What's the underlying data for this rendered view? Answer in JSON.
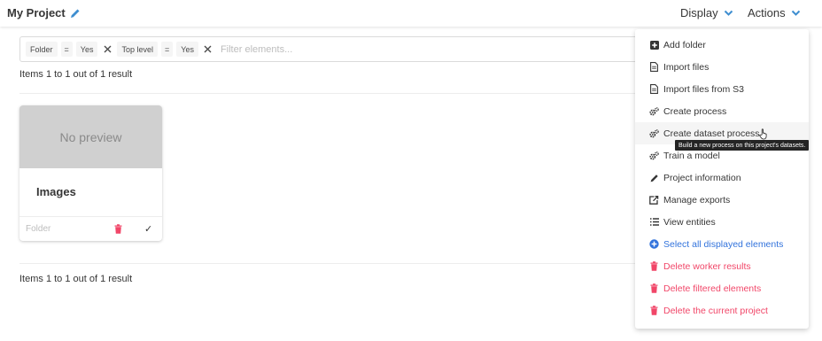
{
  "header": {
    "title": "My Project",
    "display_label": "Display",
    "actions_label": "Actions"
  },
  "filters": {
    "tags": [
      {
        "field": "Folder",
        "operator": "=",
        "value": "Yes"
      },
      {
        "field": "Top level",
        "operator": "=",
        "value": "Yes"
      }
    ],
    "placeholder": "Filter elements..."
  },
  "results": {
    "top_count": "Items 1 to 1 out of 1 result",
    "bottom_count": "Items 1 to 1 out of 1 result"
  },
  "card": {
    "preview_text": "No preview",
    "name": "Images",
    "type": "Folder",
    "check": "✓"
  },
  "actions_menu": {
    "items": [
      {
        "label": "Add folder",
        "icon": "plus-square-icon"
      },
      {
        "label": "Import files",
        "icon": "file-icon"
      },
      {
        "label": "Import files from S3",
        "icon": "file-icon"
      },
      {
        "label": "Create process",
        "icon": "cogs-icon"
      },
      {
        "label": "Create dataset process",
        "icon": "cogs-icon"
      },
      {
        "label": "Train a model",
        "icon": "cogs-icon"
      },
      {
        "label": "Project information",
        "icon": "pencil-icon"
      },
      {
        "label": "Manage exports",
        "icon": "export-icon"
      },
      {
        "label": "View entities",
        "icon": "list-icon"
      },
      {
        "label": "Select all displayed elements",
        "icon": "plus-circle-icon"
      },
      {
        "label": "Delete worker results",
        "icon": "trash-icon"
      },
      {
        "label": "Delete filtered elements",
        "icon": "trash-icon"
      },
      {
        "label": "Delete the current project",
        "icon": "trash-icon"
      }
    ],
    "tooltip": "Build a new process on this project's datasets."
  },
  "colors": {
    "link_blue": "#3273dc",
    "danger_red": "#f14668",
    "edit_icon_blue": "#3e8ed0"
  }
}
